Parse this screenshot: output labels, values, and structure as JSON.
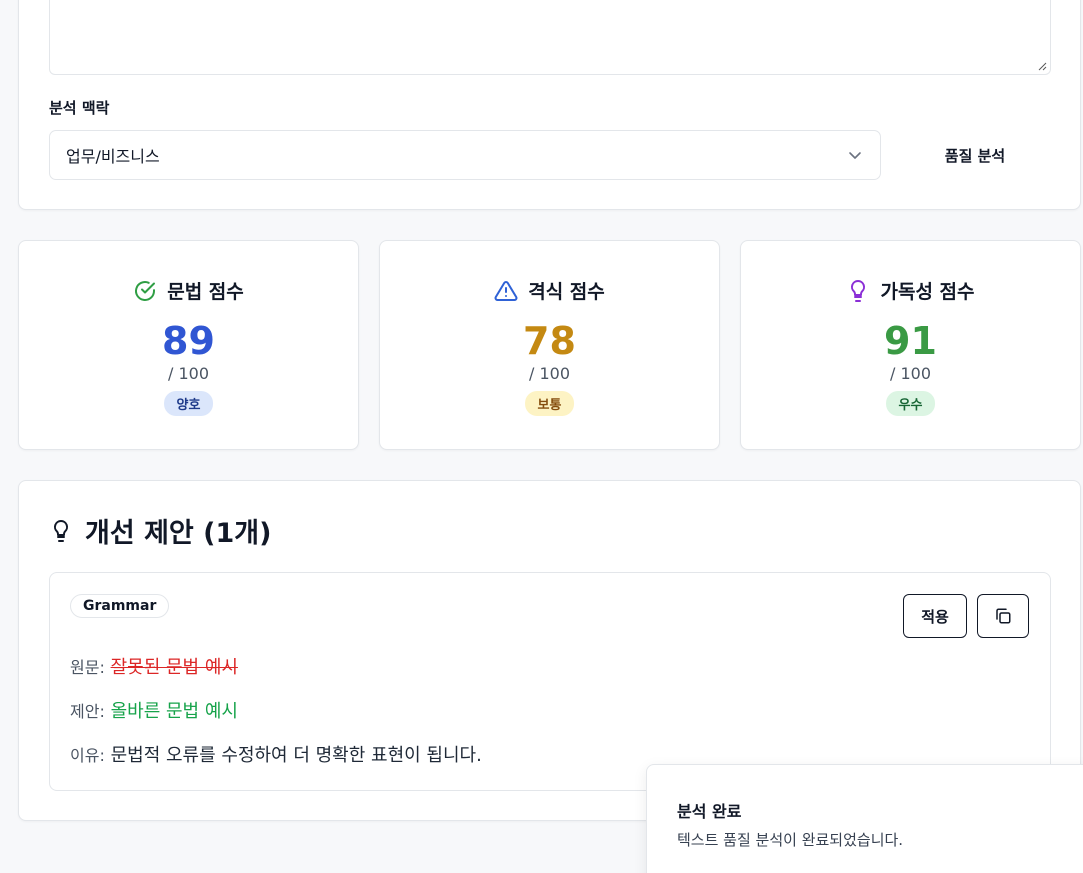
{
  "input": {
    "context_label": "분석 맥락",
    "context_value": "업무/비즈니스",
    "analyze_label": "품질 분석"
  },
  "scores": {
    "grammar": {
      "title": "문법 점수",
      "value": "89",
      "max": "/ 100",
      "badge": "양호",
      "color": "#3056d3",
      "badge_bg": "#dbe6fb",
      "badge_color": "#1e3a8a",
      "icon": "check-circle-icon"
    },
    "format": {
      "title": "격식 점수",
      "value": "78",
      "max": "/ 100",
      "badge": "보통",
      "color": "#c48912",
      "badge_bg": "#fdf3c4",
      "badge_color": "#854d0e",
      "icon": "warning-triangle-icon"
    },
    "readability": {
      "title": "가독성 점수",
      "value": "91",
      "max": "/ 100",
      "badge": "우수",
      "color": "#3a9a44",
      "badge_bg": "#dcf5e3",
      "badge_color": "#166534",
      "icon": "lightbulb-icon"
    }
  },
  "suggestions": {
    "title": "개선 제안 (1개)",
    "items": [
      {
        "tag": "Grammar",
        "apply_label": "적용",
        "original_label": "원문:",
        "original": "잘못된 문법 예시",
        "suggested_label": "제안:",
        "suggested": "올바른 문법 예시",
        "reason_label": "이유:",
        "reason": "문법적 오류를 수정하여 더 명확한 표현이 됩니다."
      }
    ]
  },
  "toast": {
    "title": "분석 완료",
    "description": "텍스트 품질 분석이 완료되었습니다."
  }
}
